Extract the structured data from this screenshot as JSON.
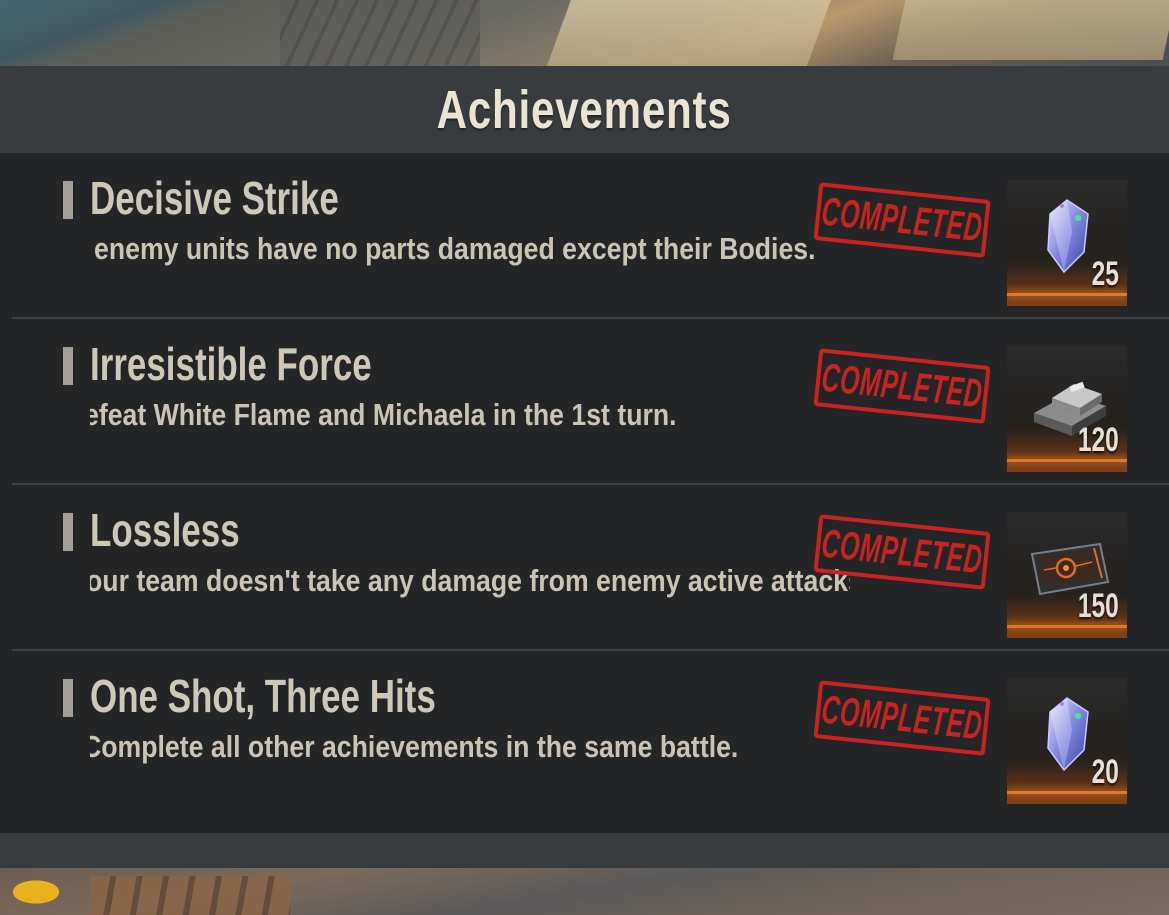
{
  "header": {
    "title": "Achievements"
  },
  "achievements": [
    {
      "title": "Decisive Strike",
      "description": "enemy units have no parts damaged except their Bodies.",
      "status": "COMPLETED",
      "reward": {
        "icon": "crystal-icon",
        "quantity": "25"
      }
    },
    {
      "title": "Irresistible Force",
      "description": "efeat White Flame and Michaela in the 1st turn.",
      "status": "COMPLETED",
      "reward": {
        "icon": "metal-ingot-icon",
        "quantity": "120"
      }
    },
    {
      "title": "Lossless",
      "description": "our team doesn't take any damage from enemy active attacks.",
      "status": "COMPLETED",
      "reward": {
        "icon": "circuit-board-icon",
        "quantity": "150"
      }
    },
    {
      "title": "One Shot, Three Hits",
      "description": "Complete all other achievements in the same battle.",
      "status": "COMPLETED",
      "reward": {
        "icon": "crystal-icon",
        "quantity": "20"
      }
    }
  ],
  "colors": {
    "panel_bg": "#232527",
    "header_bg": "#393c3f",
    "stamp_red": "#c8241f",
    "reward_accent": "#e0782a"
  }
}
